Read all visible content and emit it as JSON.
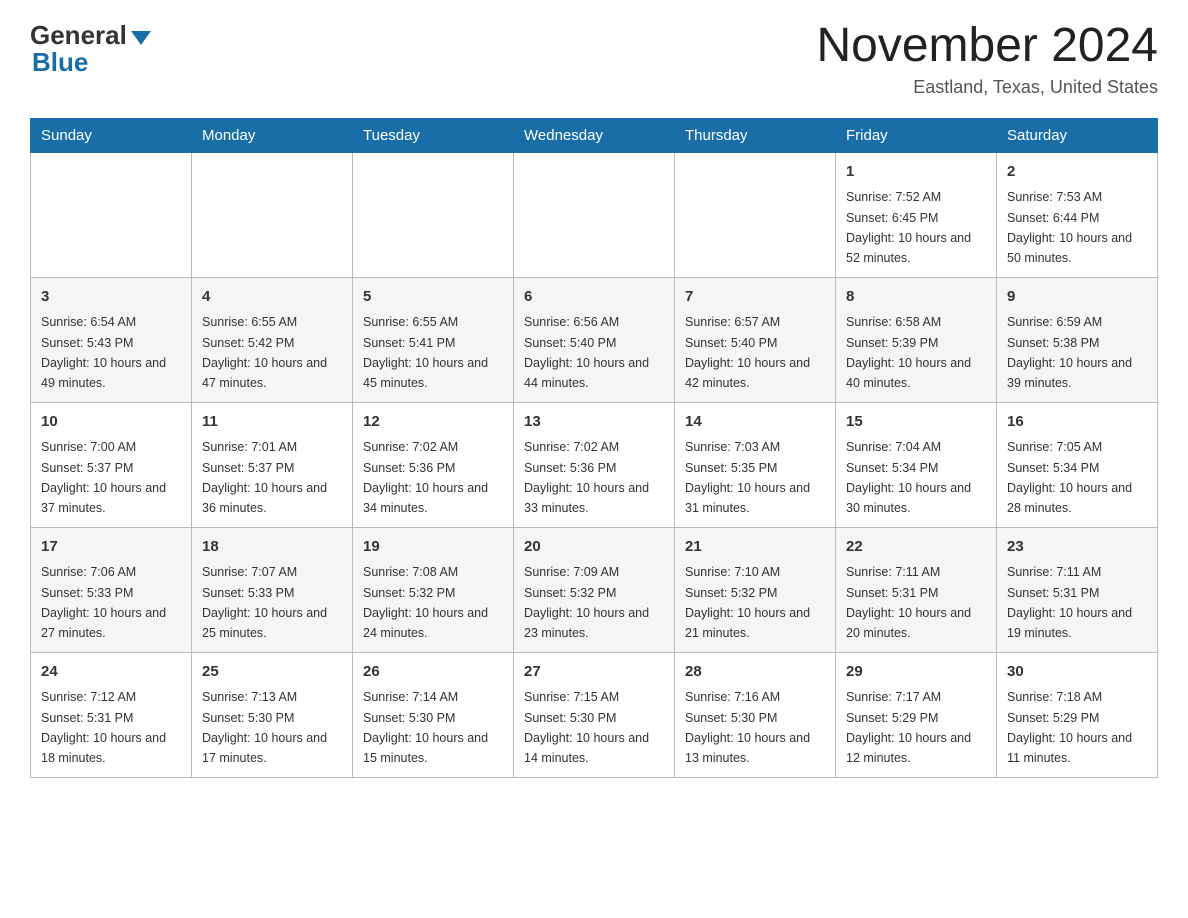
{
  "logo": {
    "general": "General",
    "blue": "Blue"
  },
  "title": {
    "month": "November 2024",
    "location": "Eastland, Texas, United States"
  },
  "weekdays": [
    "Sunday",
    "Monday",
    "Tuesday",
    "Wednesday",
    "Thursday",
    "Friday",
    "Saturday"
  ],
  "weeks": [
    [
      {
        "day": "",
        "info": ""
      },
      {
        "day": "",
        "info": ""
      },
      {
        "day": "",
        "info": ""
      },
      {
        "day": "",
        "info": ""
      },
      {
        "day": "",
        "info": ""
      },
      {
        "day": "1",
        "info": "Sunrise: 7:52 AM\nSunset: 6:45 PM\nDaylight: 10 hours and 52 minutes."
      },
      {
        "day": "2",
        "info": "Sunrise: 7:53 AM\nSunset: 6:44 PM\nDaylight: 10 hours and 50 minutes."
      }
    ],
    [
      {
        "day": "3",
        "info": "Sunrise: 6:54 AM\nSunset: 5:43 PM\nDaylight: 10 hours and 49 minutes."
      },
      {
        "day": "4",
        "info": "Sunrise: 6:55 AM\nSunset: 5:42 PM\nDaylight: 10 hours and 47 minutes."
      },
      {
        "day": "5",
        "info": "Sunrise: 6:55 AM\nSunset: 5:41 PM\nDaylight: 10 hours and 45 minutes."
      },
      {
        "day": "6",
        "info": "Sunrise: 6:56 AM\nSunset: 5:40 PM\nDaylight: 10 hours and 44 minutes."
      },
      {
        "day": "7",
        "info": "Sunrise: 6:57 AM\nSunset: 5:40 PM\nDaylight: 10 hours and 42 minutes."
      },
      {
        "day": "8",
        "info": "Sunrise: 6:58 AM\nSunset: 5:39 PM\nDaylight: 10 hours and 40 minutes."
      },
      {
        "day": "9",
        "info": "Sunrise: 6:59 AM\nSunset: 5:38 PM\nDaylight: 10 hours and 39 minutes."
      }
    ],
    [
      {
        "day": "10",
        "info": "Sunrise: 7:00 AM\nSunset: 5:37 PM\nDaylight: 10 hours and 37 minutes."
      },
      {
        "day": "11",
        "info": "Sunrise: 7:01 AM\nSunset: 5:37 PM\nDaylight: 10 hours and 36 minutes."
      },
      {
        "day": "12",
        "info": "Sunrise: 7:02 AM\nSunset: 5:36 PM\nDaylight: 10 hours and 34 minutes."
      },
      {
        "day": "13",
        "info": "Sunrise: 7:02 AM\nSunset: 5:36 PM\nDaylight: 10 hours and 33 minutes."
      },
      {
        "day": "14",
        "info": "Sunrise: 7:03 AM\nSunset: 5:35 PM\nDaylight: 10 hours and 31 minutes."
      },
      {
        "day": "15",
        "info": "Sunrise: 7:04 AM\nSunset: 5:34 PM\nDaylight: 10 hours and 30 minutes."
      },
      {
        "day": "16",
        "info": "Sunrise: 7:05 AM\nSunset: 5:34 PM\nDaylight: 10 hours and 28 minutes."
      }
    ],
    [
      {
        "day": "17",
        "info": "Sunrise: 7:06 AM\nSunset: 5:33 PM\nDaylight: 10 hours and 27 minutes."
      },
      {
        "day": "18",
        "info": "Sunrise: 7:07 AM\nSunset: 5:33 PM\nDaylight: 10 hours and 25 minutes."
      },
      {
        "day": "19",
        "info": "Sunrise: 7:08 AM\nSunset: 5:32 PM\nDaylight: 10 hours and 24 minutes."
      },
      {
        "day": "20",
        "info": "Sunrise: 7:09 AM\nSunset: 5:32 PM\nDaylight: 10 hours and 23 minutes."
      },
      {
        "day": "21",
        "info": "Sunrise: 7:10 AM\nSunset: 5:32 PM\nDaylight: 10 hours and 21 minutes."
      },
      {
        "day": "22",
        "info": "Sunrise: 7:11 AM\nSunset: 5:31 PM\nDaylight: 10 hours and 20 minutes."
      },
      {
        "day": "23",
        "info": "Sunrise: 7:11 AM\nSunset: 5:31 PM\nDaylight: 10 hours and 19 minutes."
      }
    ],
    [
      {
        "day": "24",
        "info": "Sunrise: 7:12 AM\nSunset: 5:31 PM\nDaylight: 10 hours and 18 minutes."
      },
      {
        "day": "25",
        "info": "Sunrise: 7:13 AM\nSunset: 5:30 PM\nDaylight: 10 hours and 17 minutes."
      },
      {
        "day": "26",
        "info": "Sunrise: 7:14 AM\nSunset: 5:30 PM\nDaylight: 10 hours and 15 minutes."
      },
      {
        "day": "27",
        "info": "Sunrise: 7:15 AM\nSunset: 5:30 PM\nDaylight: 10 hours and 14 minutes."
      },
      {
        "day": "28",
        "info": "Sunrise: 7:16 AM\nSunset: 5:30 PM\nDaylight: 10 hours and 13 minutes."
      },
      {
        "day": "29",
        "info": "Sunrise: 7:17 AM\nSunset: 5:29 PM\nDaylight: 10 hours and 12 minutes."
      },
      {
        "day": "30",
        "info": "Sunrise: 7:18 AM\nSunset: 5:29 PM\nDaylight: 10 hours and 11 minutes."
      }
    ]
  ]
}
